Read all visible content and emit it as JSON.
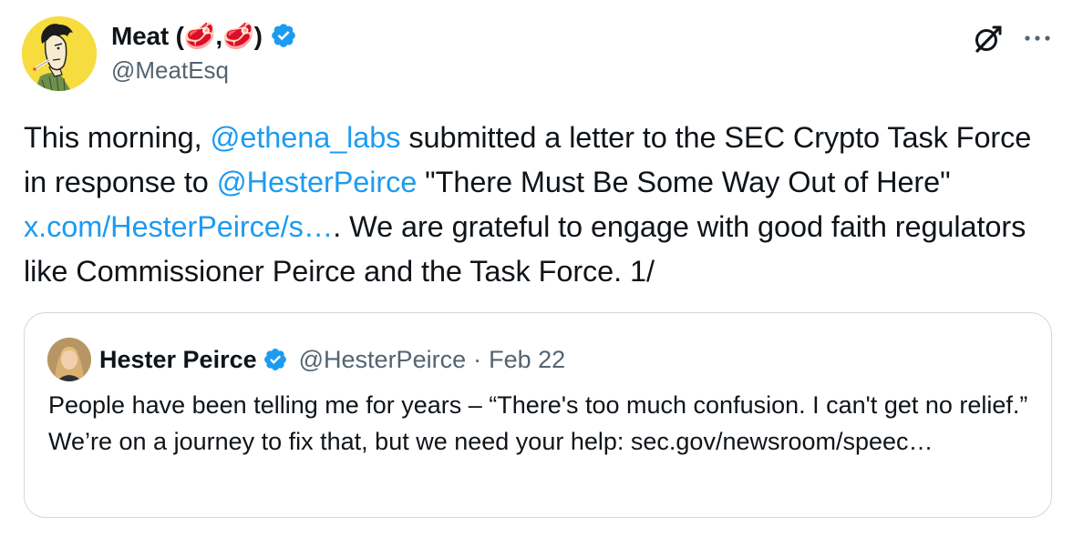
{
  "tweet": {
    "author": {
      "display_name": "Meat (🥩,🥩)",
      "handle": "@MeatEsq",
      "verified": true
    },
    "text_parts": {
      "p1": "This morning, ",
      "mention1": "@ethena_labs",
      "p2": " submitted a letter to the SEC Crypto Task Force in response to ",
      "mention2": "@HesterPeirce",
      "p3": " \"There Must Be Some Way Out of Here\" ",
      "link": "x.com/HesterPeirce/s…",
      "p4": ". We are grateful to engage with good faith regulators like Commissioner Peirce and the Task Force. 1/"
    },
    "icons": {
      "grok": "grok-icon",
      "more": "more-icon",
      "verified": "verified-badge-icon"
    }
  },
  "quote": {
    "author": {
      "display_name": "Hester Peirce",
      "handle": "@HesterPeirce",
      "separator": "·",
      "date": "Feb 22",
      "verified": true
    },
    "text": "People have been telling me for years – “There's too much confusion. I can't get no relief.” We’re on a journey to fix that, but we need your help: ",
    "link": "sec.gov/newsroom/speec…"
  },
  "colors": {
    "accent": "#1d9bf0",
    "text": "#0f1419",
    "secondary": "#536471",
    "border": "#cfd9de",
    "avatar_bg": "#f6dc3e"
  }
}
